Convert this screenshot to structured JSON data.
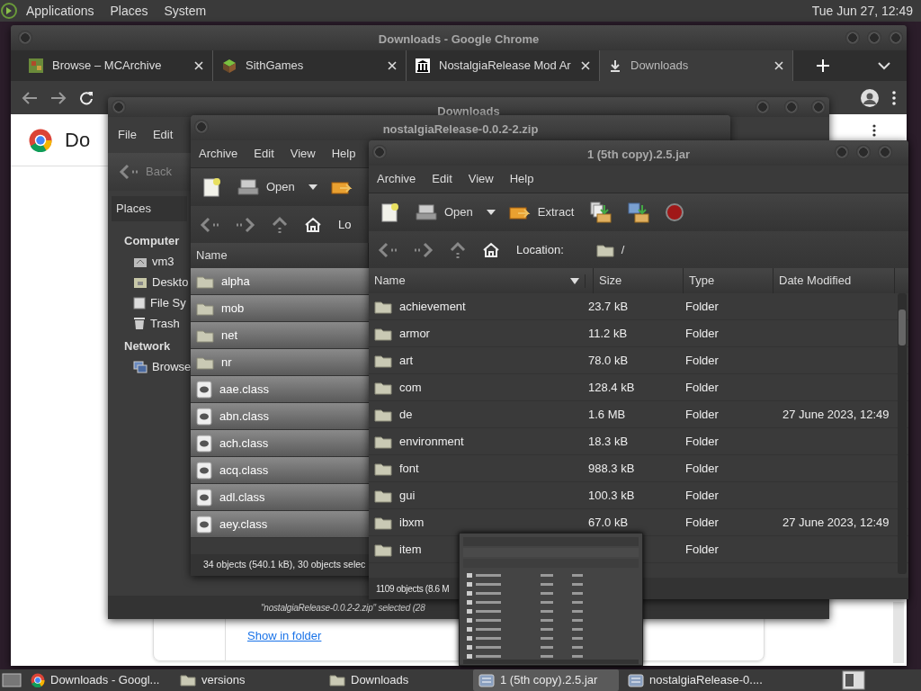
{
  "top_panel": {
    "menus": [
      "Applications",
      "Places",
      "System"
    ],
    "clock": "Tue Jun 27, 12:49"
  },
  "chrome": {
    "title": "Downloads - Google Chrome",
    "tabs": [
      {
        "label": "Browse – MCArchive",
        "selected": false
      },
      {
        "label": "SithGames",
        "selected": false
      },
      {
        "label": "NostalgiaRelease Mod Ar",
        "selected": false
      },
      {
        "label": "Downloads",
        "selected": true
      }
    ],
    "page": {
      "heading": "Do",
      "link": "Show in folder"
    }
  },
  "file_manager": {
    "title": "Downloads",
    "menus": [
      "File",
      "Edit"
    ],
    "back": "Back",
    "sidebar_title": "Places",
    "sidebar": [
      {
        "label": "Computer",
        "children": [
          {
            "label": "vm3",
            "kind": "home"
          },
          {
            "label": "Deskto",
            "kind": "desktop"
          },
          {
            "label": "File Sy",
            "kind": "drive"
          },
          {
            "label": "Trash",
            "kind": "trash"
          }
        ]
      },
      {
        "label": "Network",
        "children": [
          {
            "label": "Browse",
            "kind": "network"
          }
        ]
      }
    ],
    "status": "\"nostalgiaRelease-0.0.2-2.zip\" selected (28"
  },
  "archive_back": {
    "title": "nostalgiaRelease-0.0.2-2.zip",
    "menus": [
      "Archive",
      "Edit",
      "View",
      "Help"
    ],
    "open": "Open",
    "location": "Lo",
    "columns": [
      "Name"
    ],
    "rows": [
      {
        "name": "alpha",
        "kind": "folder",
        "selected": true
      },
      {
        "name": "mob",
        "kind": "folder",
        "selected": true
      },
      {
        "name": "net",
        "kind": "folder",
        "selected": true
      },
      {
        "name": "nr",
        "kind": "folder",
        "selected": true
      },
      {
        "name": "aae.class",
        "kind": "class",
        "selected": true
      },
      {
        "name": "abn.class",
        "kind": "class",
        "selected": true
      },
      {
        "name": "ach.class",
        "kind": "class",
        "selected": true
      },
      {
        "name": "acq.class",
        "kind": "class",
        "selected": true
      },
      {
        "name": "adl.class",
        "kind": "class",
        "selected": true
      },
      {
        "name": "aey.class",
        "kind": "class",
        "selected": true
      }
    ],
    "status": "34 objects (540.1 kB), 30 objects selec"
  },
  "archive_front": {
    "title": "1 (5th copy).2.5.jar",
    "menus": [
      "Archive",
      "Edit",
      "View",
      "Help"
    ],
    "open": "Open",
    "extract": "Extract",
    "location_label": "Location:",
    "location": "/",
    "columns": [
      "Name",
      "Size",
      "Type",
      "Date Modified"
    ],
    "rows": [
      {
        "name": "achievement",
        "size": "23.7 kB",
        "type": "Folder",
        "modified": "",
        "selected": false
      },
      {
        "name": "armor",
        "size": "11.2 kB",
        "type": "Folder",
        "modified": "",
        "selected": false
      },
      {
        "name": "art",
        "size": "78.0 kB",
        "type": "Folder",
        "modified": "",
        "selected": false
      },
      {
        "name": "com",
        "size": "128.4 kB",
        "type": "Folder",
        "modified": "",
        "selected": false
      },
      {
        "name": "de",
        "size": "1.6 MB",
        "type": "Folder",
        "modified": "27 June 2023, 12:49",
        "selected": false
      },
      {
        "name": "environment",
        "size": "18.3 kB",
        "type": "Folder",
        "modified": "",
        "selected": false
      },
      {
        "name": "font",
        "size": "988.3 kB",
        "type": "Folder",
        "modified": "",
        "selected": false
      },
      {
        "name": "gui",
        "size": "100.3 kB",
        "type": "Folder",
        "modified": "",
        "selected": false
      },
      {
        "name": "ibxm",
        "size": "67.0 kB",
        "type": "Folder",
        "modified": "27 June 2023, 12:49",
        "selected": false
      },
      {
        "name": "item",
        "size": "",
        "type": "Folder",
        "modified": "",
        "selected": false
      }
    ],
    "status": "1109 objects (8.6 M"
  },
  "taskbar": [
    {
      "label": "Downloads - Googl...",
      "kind": "browser",
      "selected": false
    },
    {
      "label": "versions",
      "kind": "folder",
      "selected": false
    },
    {
      "label": "Downloads",
      "kind": "folder",
      "selected": false
    },
    {
      "label": "1 (5th copy).2.5.jar",
      "kind": "archive",
      "selected": true
    },
    {
      "label": "nostalgiaRelease-0....",
      "kind": "archive",
      "selected": false
    }
  ]
}
